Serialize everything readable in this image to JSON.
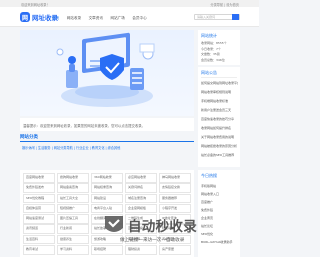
{
  "topbar": {
    "welcome": "欢迎来到网址收录！",
    "links": "分类导航 | 设为首页"
  },
  "header": {
    "logo_text": "网址收录",
    "logo_glyph": "网",
    "nav": [
      "首页",
      "网站收录",
      "文章资讯",
      "网站广场",
      "会员中心"
    ],
    "search_placeholder": "请输入关键词"
  },
  "notice": "温馨提示：欢迎您来到网址收录，如果您的网站未被收录，您可以点击提交收录。",
  "category": {
    "title": "网站分类",
    "items": "娱乐休闲  |  生活服务  |  网站分类导航  |  行业企业  |  教育文化  |  综合其他"
  },
  "grid": {
    "cells": [
      "百度网站收录",
      "搜狗网站收录",
      "360网站收录",
      "必应网站收录",
      "神马网站收录",
      "免费外链发布",
      "网站备案查询",
      "网站权重查询",
      "关键词排名",
      "友情链接交换",
      "SEO优化教程",
      "站长工具大全",
      "网站建设",
      "域名注册查询",
      "服务器推荐",
      "自媒体运营",
      "短视频推广",
      "电商平台入驻",
      "企业官网模板",
      "小程序开发",
      "网站速度测试",
      "图片压缩工具",
      "在线翻译",
      "二维码生成",
      "IP地址查询",
      "资讯频道",
      "行业新闻",
      "站长故事",
      "互联网观察",
      "科技动态",
      "生活百科",
      "健康养生",
      "旅游攻略",
      "美食推荐",
      "汽车频道",
      "教育考试",
      "学习资料",
      "职场招聘",
      "理财投资",
      "房产家居"
    ]
  },
  "stats": {
    "title": "网站统计",
    "rows": [
      "收录网站：8555个",
      "今日收录：7个",
      "文章数：35篇",
      "会员总数：346位"
    ]
  },
  "announce": {
    "title": "网站公告",
    "items": [
      "如何提交网站到网址收录平台",
      "网站收录审核规则说明",
      "手机端网站收录标准",
      "新用户注册送会员三天",
      "百度快速收录的技巧分享",
      "收录网站如何提升排名",
      "关于网站收录费用的说明",
      "网站被拒绝收录的原因分析",
      "站长必备的SEO工具推荐"
    ]
  },
  "today": {
    "title": "今日热搜",
    "items": [
      "手机版网站",
      "网站收录入口",
      "百度推广",
      "免费外链",
      "企业黄页",
      "站长论坛",
      "SEO优化",
      "BURL-GitHub收录助手"
    ]
  },
  "watermark": {
    "title": "自动秒收录",
    "subtitle": "做上链接一来访一次一自动收录",
    "brand_color": "#2a6ef5"
  }
}
